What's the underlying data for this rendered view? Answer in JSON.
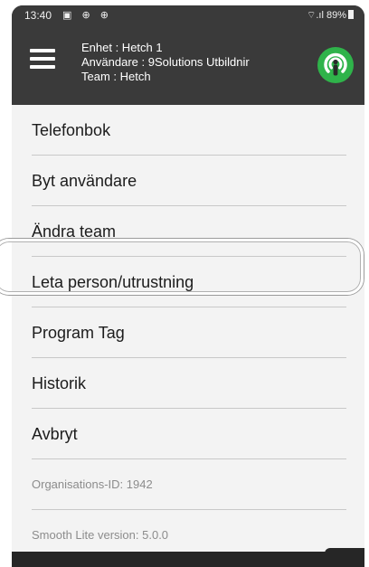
{
  "status_bar": {
    "time": "13:40",
    "left_icons": "▣ ⊕ ⊕",
    "signal_battery": "⌔.ıl 89%"
  },
  "header": {
    "unit_line": "Enhet : Hetch 1",
    "user_line": "Användare : 9Solutions Utbildnir",
    "team_line": "Team : Hetch",
    "logo_icon": "person-locator-icon",
    "accent_color": "#2fb34a",
    "bar_color": "#3a3a3a"
  },
  "menu": {
    "items": [
      {
        "label": "Telefonbok"
      },
      {
        "label": "Byt användare"
      },
      {
        "label": "Ändra team"
      },
      {
        "label": "Leta person/utrustning",
        "highlighted": true
      },
      {
        "label": "Program Tag"
      },
      {
        "label": "Historik"
      },
      {
        "label": "Avbryt"
      }
    ],
    "info": {
      "organisation_id": "Organisations-ID: 1942",
      "version": "Smooth Lite version: 5.0.0"
    }
  }
}
